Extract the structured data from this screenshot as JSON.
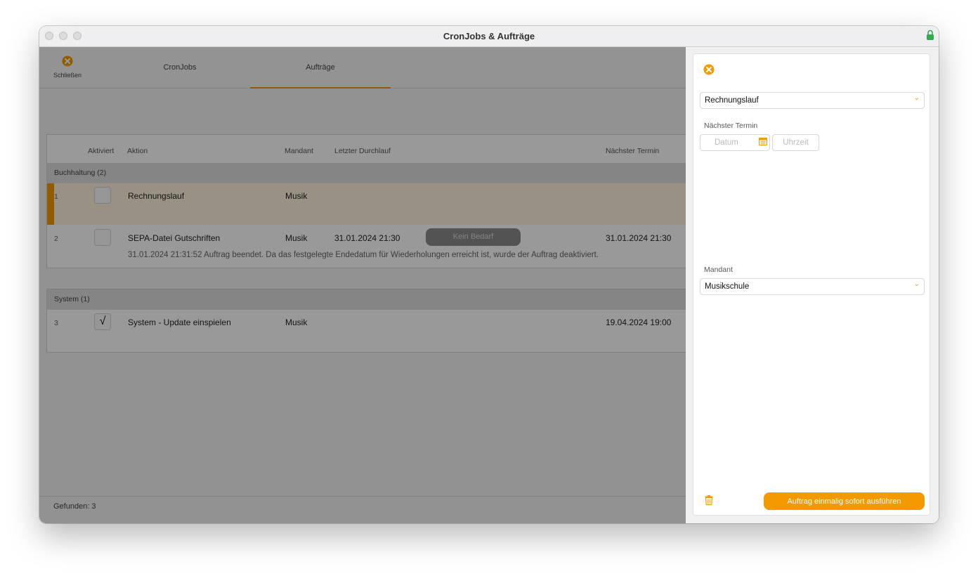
{
  "window": {
    "title": "CronJobs & Aufträge"
  },
  "toolbar": {
    "close_label": "Schließen",
    "tabs": [
      {
        "label": "CronJobs"
      },
      {
        "label": "Aufträge"
      }
    ]
  },
  "table": {
    "headers": {
      "aktiviert": "Aktiviert",
      "aktion": "Aktion",
      "mandant": "Mandant",
      "letzter": "Letzter Durchlauf",
      "naechster": "Nächster Termin"
    },
    "groups": [
      {
        "label": "Buchhaltung (2)",
        "rows": [
          {
            "num": "1",
            "checked": "",
            "aktion": "Rechnungslauf",
            "mandant": "Musik",
            "letzter": "",
            "status": "",
            "naechster": "",
            "note": ""
          },
          {
            "num": "2",
            "checked": "",
            "aktion": "SEPA-Datei Gutschriften",
            "mandant": "Musik",
            "letzter": "31.01.2024 21:30",
            "status": "Kein Bedarf",
            "naechster": "31.01.2024 21:30",
            "note": "31.01.2024 21:31:52 Auftrag beendet. Da das festgelegte Endedatum für Wiederholungen erreicht ist, wurde der Auftrag deaktiviert."
          }
        ]
      },
      {
        "label": "System (1)",
        "rows": [
          {
            "num": "3",
            "checked": "√",
            "aktion": "System - Update einspielen",
            "mandant": "Musik",
            "letzter": "",
            "status": "",
            "naechster": "19.04.2024 19:00",
            "note": ""
          }
        ]
      }
    ]
  },
  "footer": {
    "found": "Gefunden: 3"
  },
  "panel": {
    "job_select": "Rechnungslauf",
    "next_label": "Nächster Termin",
    "date_placeholder": "Datum",
    "time_placeholder": "Uhrzeit",
    "mandant_label": "Mandant",
    "mandant_select": "Musikschule",
    "run_button": "Auftrag einmalig sofort ausführen"
  },
  "colors": {
    "accent": "#f29a00",
    "selection_row": "#fff2dc"
  }
}
